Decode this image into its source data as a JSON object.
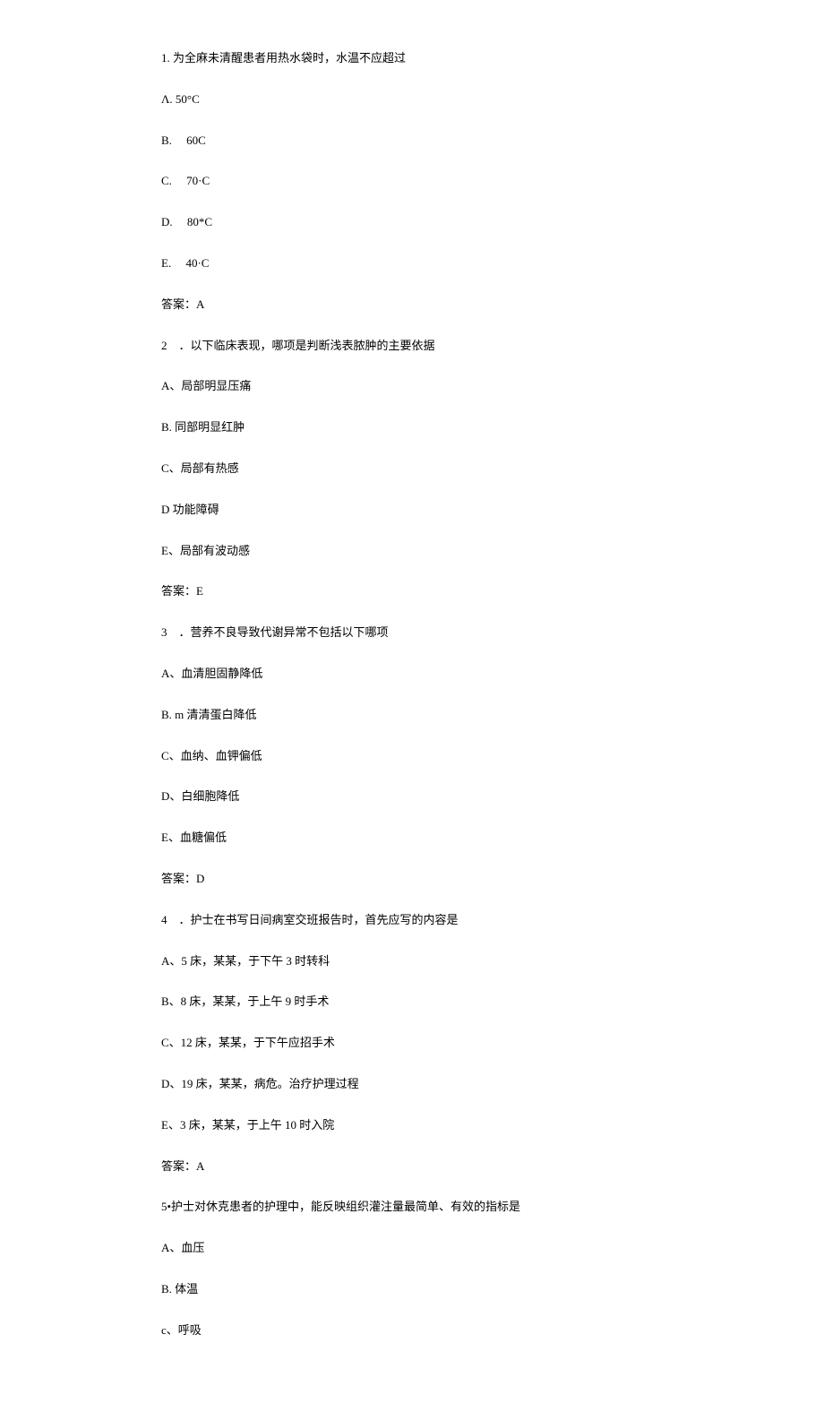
{
  "q1": {
    "text": "1. 为全麻未清醒患者用热水袋时，水温不应超过",
    "optA": "Λ. 50°C",
    "optB": "B.　 60C",
    "optC": "C.　 70·C",
    "optD": "D.　 80*C",
    "optE": "E.　 40·C",
    "answer": "答案：A"
  },
  "q2": {
    "text": "2　．以下临床表现，哪项是判断浅表脓肿的主要依据",
    "optA": "A、局部明显压痛",
    "optB": "B. 同部明显红肿",
    "optC": "C、局部有热感",
    "optD": "D 功能障碍",
    "optE": "E、局部有波动感",
    "answer": "答案：E"
  },
  "q3": {
    "text": "3　．营养不良导致代谢异常不包括以下哪项",
    "optA": "A、血清胆固静降低",
    "optB": "B. m 清清蛋白降低",
    "optC": "C、血纳、血钾偏低",
    "optD": "D、白细胞降低",
    "optE": "E、血糖偏低",
    "answer": "答案：D"
  },
  "q4": {
    "text": "4　．护士在书写日间病室交班报告时，首先应写的内容是",
    "optA": "A、5 床，某某，于下午 3 时转科",
    "optB": "B、8 床，某某，于上午 9 时手术",
    "optC": "C、12 床，某某，于下午应招手术",
    "optD": "D、19 床，某某，病危。治疗护理过程",
    "optE": "E、3 床，某某，于上午 10 时入院",
    "answer": "答案：A"
  },
  "q5": {
    "text": "5•护士对休克患者的护理中，能反映组织灌注量最简单、有效的指标是",
    "optA": "A、血压",
    "optB": "B. 体温",
    "optC": "c、呼吸"
  }
}
